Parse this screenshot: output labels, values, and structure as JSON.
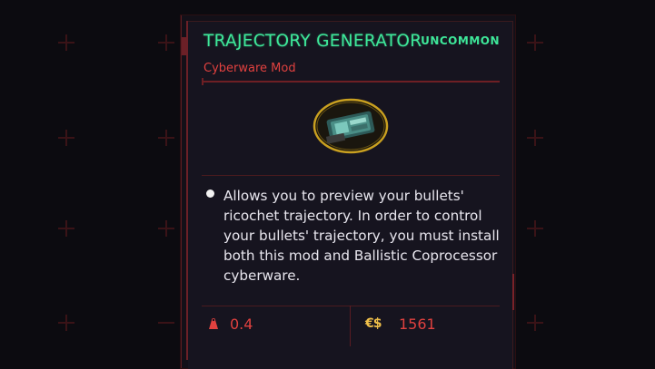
{
  "item": {
    "name": "TRAJECTORY GENERATOR",
    "rarity": "UNCOMMON",
    "type": "Cyberware Mod",
    "icon": "cyberware-chip-icon",
    "description": "Allows you to preview your bullets' ricochet trajectory. In order to control your bullets' trajectory, you must install both this mod and Ballistic Coprocessor cyberware.",
    "weight": "0.4",
    "currency_symbol": "€$",
    "price": "1561"
  },
  "colors": {
    "rarity_green": "#3ee89a",
    "accent_red": "#e0413f",
    "eddie_gold": "#f0c04a",
    "panel_bg": "#16141f"
  }
}
